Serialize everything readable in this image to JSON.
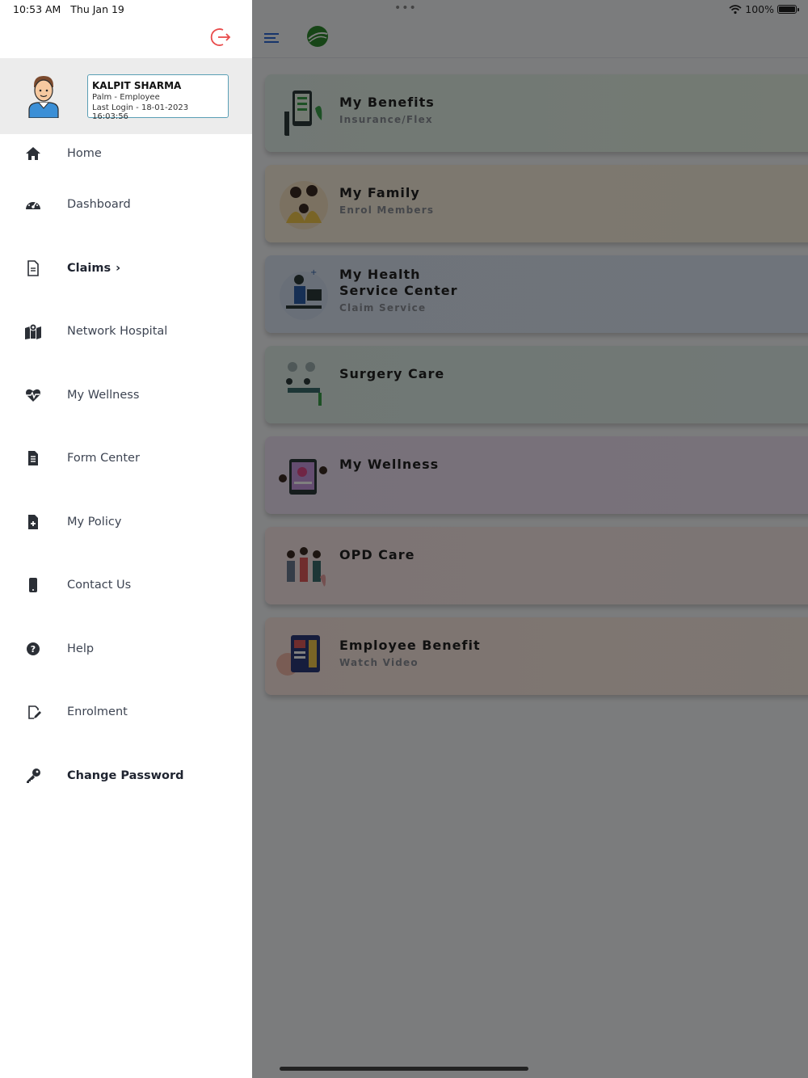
{
  "status_bar": {
    "time": "10:53 AM",
    "date": "Thu Jan 19",
    "dots": "•••",
    "battery": "100%"
  },
  "drawer": {
    "user": {
      "name": "KALPIT SHARMA",
      "role": "Palm - Employee",
      "last_login": "Last Login - 18-01-2023 16:03:56"
    },
    "items": [
      {
        "label": "Home",
        "icon": "home-icon"
      },
      {
        "label": "Dashboard",
        "icon": "dashboard-icon"
      },
      {
        "label": "Claims",
        "icon": "document-icon",
        "chevron": "›"
      },
      {
        "label": "Network Hospital",
        "icon": "map-location-icon"
      },
      {
        "label": "My Wellness",
        "icon": "heart-pulse-icon"
      },
      {
        "label": "Form Center",
        "icon": "form-icon"
      },
      {
        "label": "My Policy",
        "icon": "file-plus-icon"
      },
      {
        "label": "Contact Us",
        "icon": "mobile-icon"
      },
      {
        "label": "Help",
        "icon": "help-icon"
      },
      {
        "label": "Enrolment",
        "icon": "edit-file-icon"
      },
      {
        "label": "Change Password",
        "icon": "key-icon"
      }
    ]
  },
  "main": {
    "cards": [
      {
        "title": "My Benefits",
        "sub": "Insurance/Flex"
      },
      {
        "title": "My Family",
        "sub": "Enrol Members"
      },
      {
        "title": "My Health",
        "title2": "Service Center",
        "sub": "Claim Service"
      },
      {
        "title": "Surgery Care"
      },
      {
        "title": "My Wellness"
      },
      {
        "title": "OPD Care"
      },
      {
        "title": "Employee Benefit",
        "sub": "Watch Video"
      }
    ]
  },
  "colors": {
    "accent": "#2f6bd6",
    "logout": "#e94b4b",
    "profile_border": "#5a9fb5",
    "overlay": "rgba(0,0,0,0.5)"
  }
}
